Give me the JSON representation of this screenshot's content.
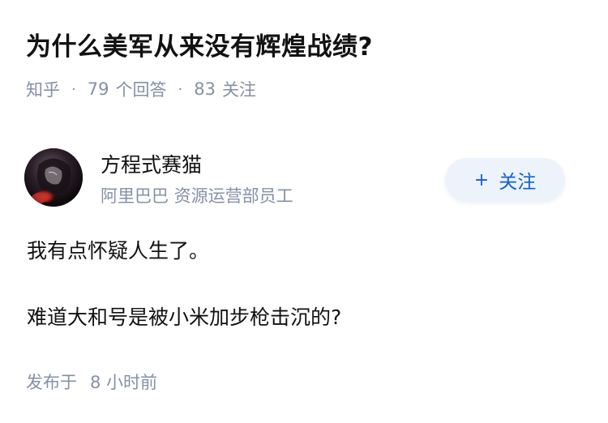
{
  "question": {
    "title": "为什么美军从来没有辉煌战绩?",
    "source": "知乎",
    "answer_count": "79",
    "answer_label": "个回答",
    "follower_count": "83",
    "follower_label": "关注",
    "separator": "·"
  },
  "author": {
    "name": "方程式赛猫",
    "headline": "阿里巴巴 资源运营部员工",
    "avatar_icon": "avatar-image",
    "follow_button": {
      "plus": "+",
      "label": "关注"
    }
  },
  "answer": {
    "paragraphs": [
      "我有点怀疑人生了。",
      "难道大和号是被小米加步枪击沉的?"
    ],
    "published_label": "发布于",
    "published_time": "8 小时前"
  },
  "colors": {
    "title": "#121212",
    "meta": "#8590a6",
    "follow_bg": "#edf3fa",
    "follow_text": "#0f5fd8"
  }
}
